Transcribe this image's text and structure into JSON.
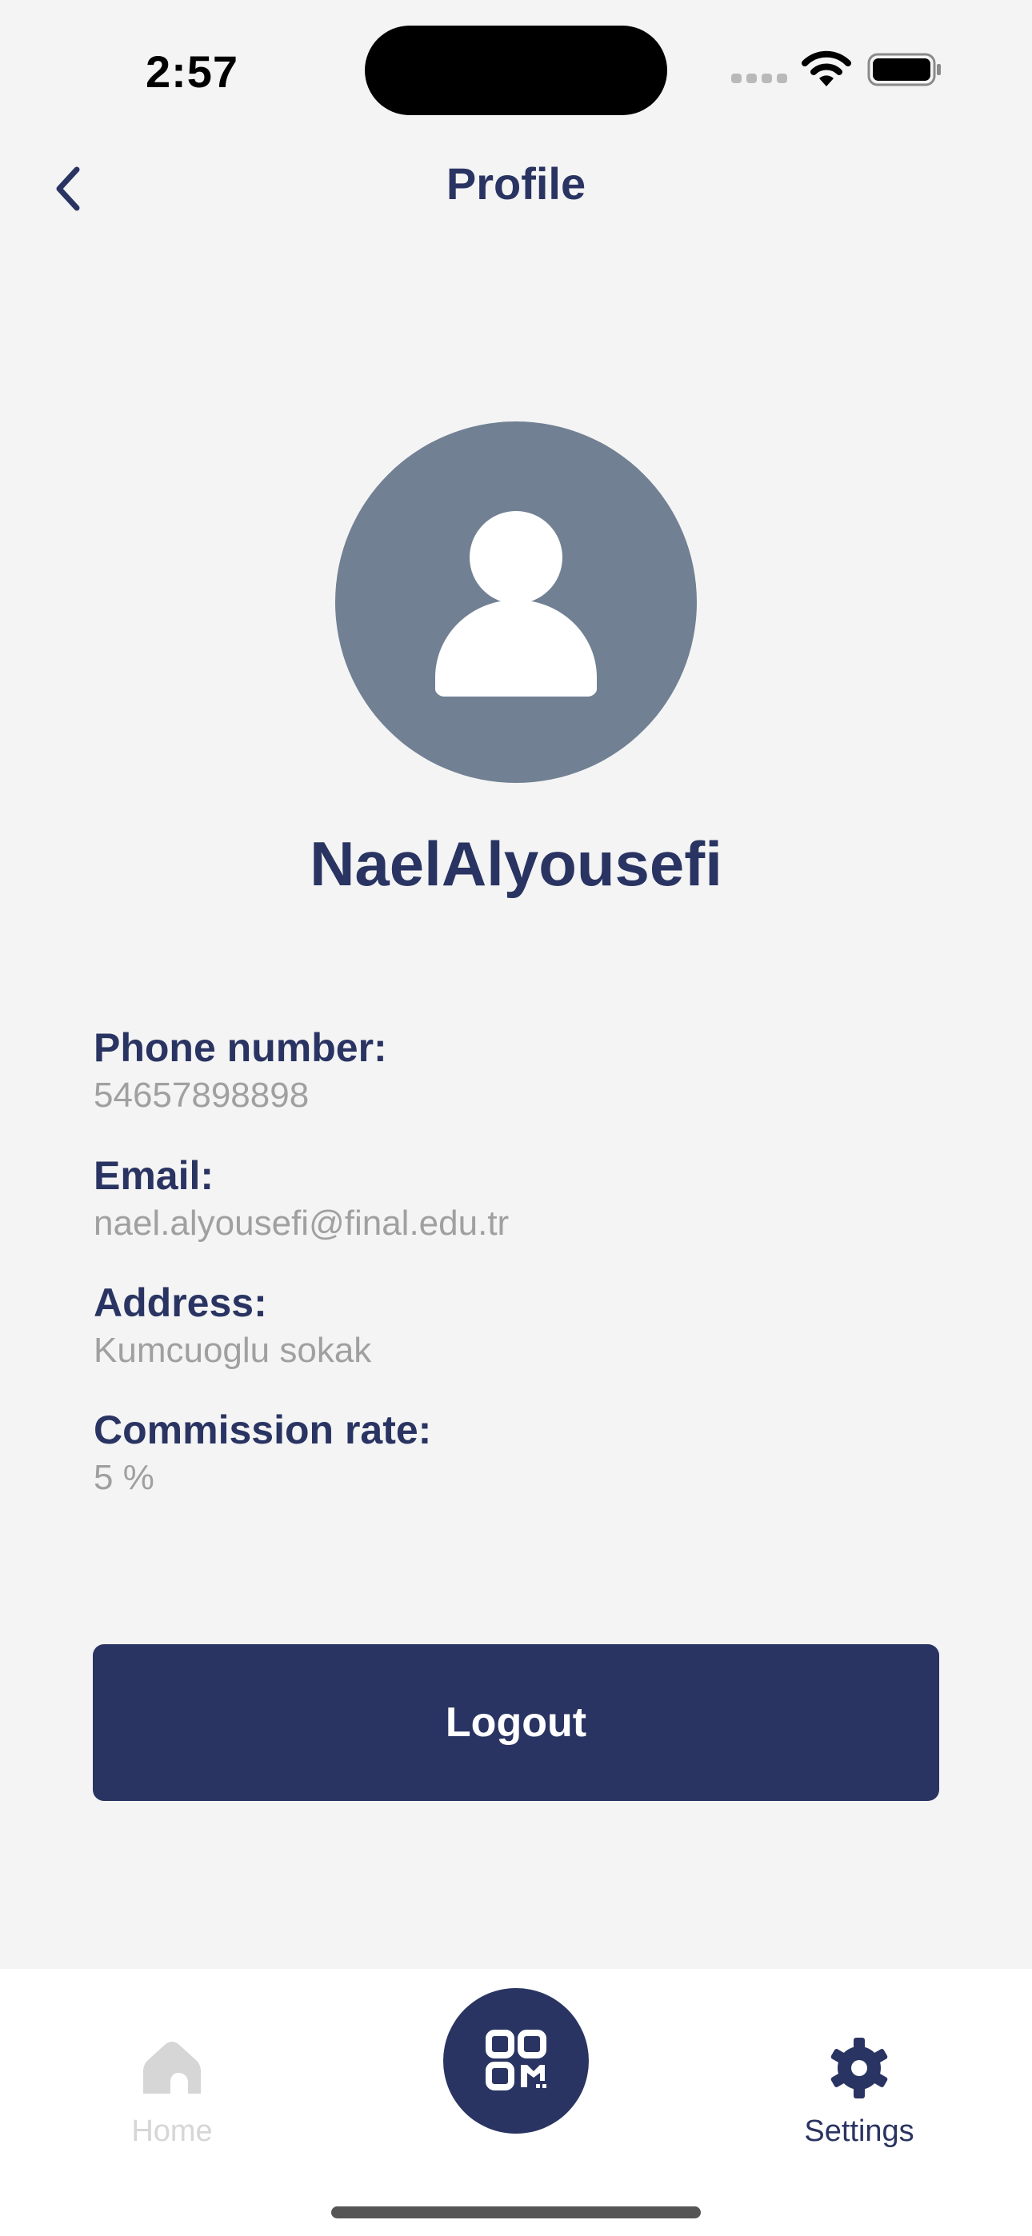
{
  "status_bar": {
    "time": "2:57"
  },
  "header": {
    "title": "Profile",
    "back_icon": "chevron-left-icon"
  },
  "profile": {
    "avatar_icon": "user-placeholder-icon",
    "name": "NaelAlyousefi",
    "fields": [
      {
        "label": "Phone number:",
        "value": "54657898898"
      },
      {
        "label": "Email:",
        "value": "nael.alyousefi@final.edu.tr"
      },
      {
        "label": "Address:",
        "value": "Kumcuoglu sokak"
      },
      {
        "label": "Commission rate:",
        "value": "5 %"
      }
    ]
  },
  "actions": {
    "logout_label": "Logout"
  },
  "tab_bar": {
    "home": {
      "label": "Home",
      "icon": "home-icon",
      "active": false
    },
    "scan": {
      "icon": "qr-code-icon"
    },
    "settings": {
      "label": "Settings",
      "icon": "gear-icon",
      "active": true
    }
  },
  "colors": {
    "primary": "#2a3462",
    "background": "#f4f4f4",
    "muted_text": "#a0a0a0",
    "avatar_bg": "#718093",
    "inactive_tab": "#d6d6d6"
  }
}
